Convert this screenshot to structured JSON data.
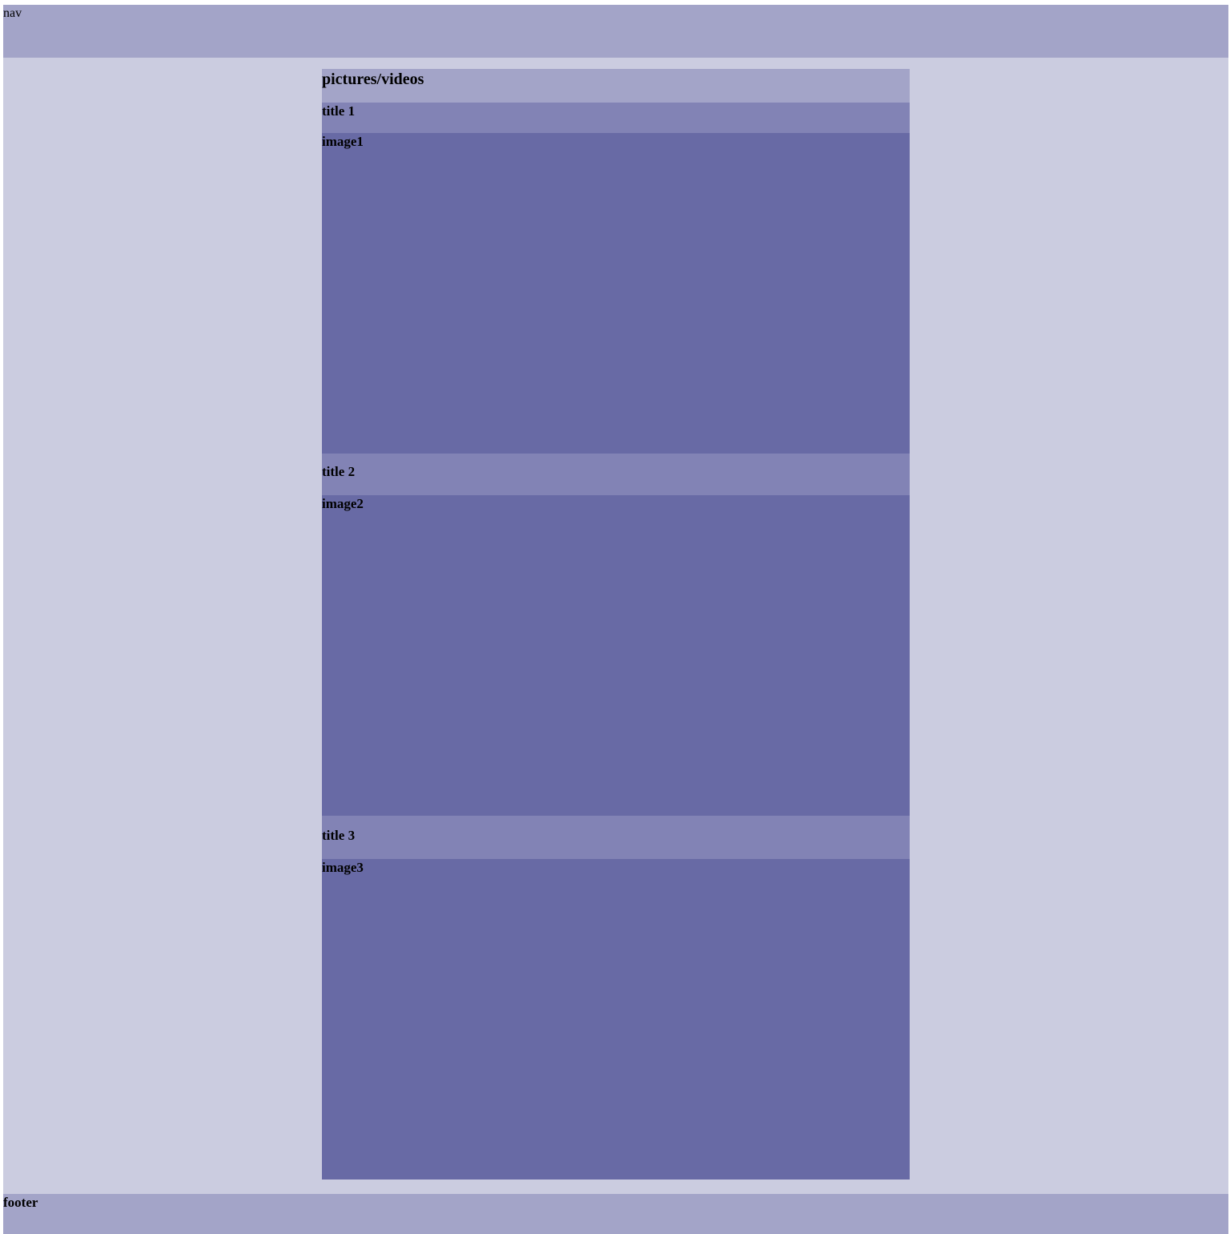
{
  "nav": {
    "label": "nav"
  },
  "gallery": {
    "heading": "pictures/videos",
    "items": [
      {
        "title": "title 1",
        "image_label": "image1"
      },
      {
        "title": "title 2",
        "image_label": "image2"
      },
      {
        "title": "title 3",
        "image_label": "image3"
      }
    ]
  },
  "footer": {
    "label": "footer"
  },
  "colors": {
    "page_background": "#cbcce0",
    "nav_footer_background": "#a3a4c8",
    "title_bar_background": "#8283b5",
    "image_background": "#686aa5"
  }
}
